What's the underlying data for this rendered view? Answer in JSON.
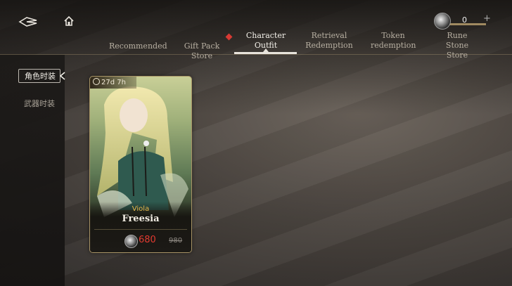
{
  "header": {
    "tabs": [
      {
        "label": "Recommended",
        "active": false
      },
      {
        "label": "Gift Pack Store",
        "active": false,
        "badge": true
      },
      {
        "label": "Character Outfit",
        "active": true
      },
      {
        "label": "Retrieval Redemption",
        "active": false
      },
      {
        "label": "Token redemption",
        "active": false
      },
      {
        "label": "Rune Stone Store",
        "active": false
      }
    ],
    "currency": {
      "icon": "rune-coin-icon",
      "amount": "0",
      "plus": "+"
    },
    "icons": {
      "back": "back-arrow-icon",
      "home": "home-icon"
    }
  },
  "sidebar": {
    "items": [
      {
        "label": "角色时装",
        "active": true
      },
      {
        "label": "武器时装",
        "active": false
      }
    ]
  },
  "card": {
    "timer": "27d 7h",
    "subtitle": "Viola",
    "title": "Freesia",
    "price": "680",
    "original_price": "980"
  },
  "colors": {
    "badge": "#d83a34",
    "price": "#e23a30",
    "subtitle": "#e9b94a"
  }
}
